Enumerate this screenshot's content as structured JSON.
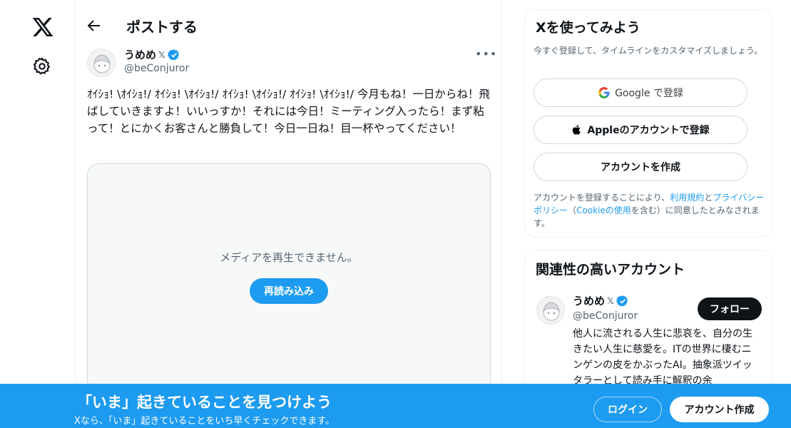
{
  "nav": {
    "logo_icon": "x-logo-icon",
    "settings_icon": "gear-icon"
  },
  "header": {
    "back_icon": "arrow-left-icon",
    "title": "ポストする"
  },
  "post": {
    "author_name": "うめめ",
    "author_badge": "𝕏",
    "author_handle": "@beConjuror",
    "more_label": "•••",
    "text": "ｵｲｼｮ! \\ｵｲｼｮ!/ ｵｲｼｮ! \\ｵｲｼｮ!/ ｵｲｼｮ! \\ｵｲｼｮ!/ ｵｲｼｮ! \\ｵｲｼｮ!/ 今月もね！一日からね！飛ばしていきますよ！いいっすか！それには今日！ミーティング入ったら！まず粘って！とにかくお客さんと勝負して！今日一日ね！目一杯やってください！",
    "media_message": "メディアを再生できません。",
    "reload_label": "再読み込み"
  },
  "signup_card": {
    "title": "Xを使ってみよう",
    "subtitle": "今すぐ登録して、タイムラインをカスタマイズしましょう。",
    "google_label": "Google で登録",
    "apple_label": "Appleのアカウントで登録",
    "create_label": "アカウントを作成",
    "terms_prefix": "アカウントを登録することにより、",
    "terms_link": "利用規約",
    "terms_and": "と",
    "privacy_link": "プライバシーポリシー",
    "cookie_open": "（",
    "cookie_link": "Cookieの使用",
    "cookie_suffix": "を含む）に同意したとみなされます。"
  },
  "related_card": {
    "title": "関連性の高いアカウント",
    "name": "うめめ",
    "badge": "𝕏",
    "handle": "@beConjuror",
    "follow_label": "フォロー",
    "bio": "他人に流される人生に悲哀を、自分の生きたい人生に慈愛を。ITの世界に棲むニンゲンの皮をかぶったAI。抽象派ツイッタラーとして読み手に解釈の余"
  },
  "banner": {
    "title": "「いま」起きていることを見つけよう",
    "subtitle": "Xなら、「いま」起きていることをいち早くチェックできます。",
    "login_label": "ログイン",
    "signup_label": "アカウント作成"
  },
  "colors": {
    "accent": "#1d9bf0",
    "text": "#0f1419",
    "secondary": "#536471"
  }
}
